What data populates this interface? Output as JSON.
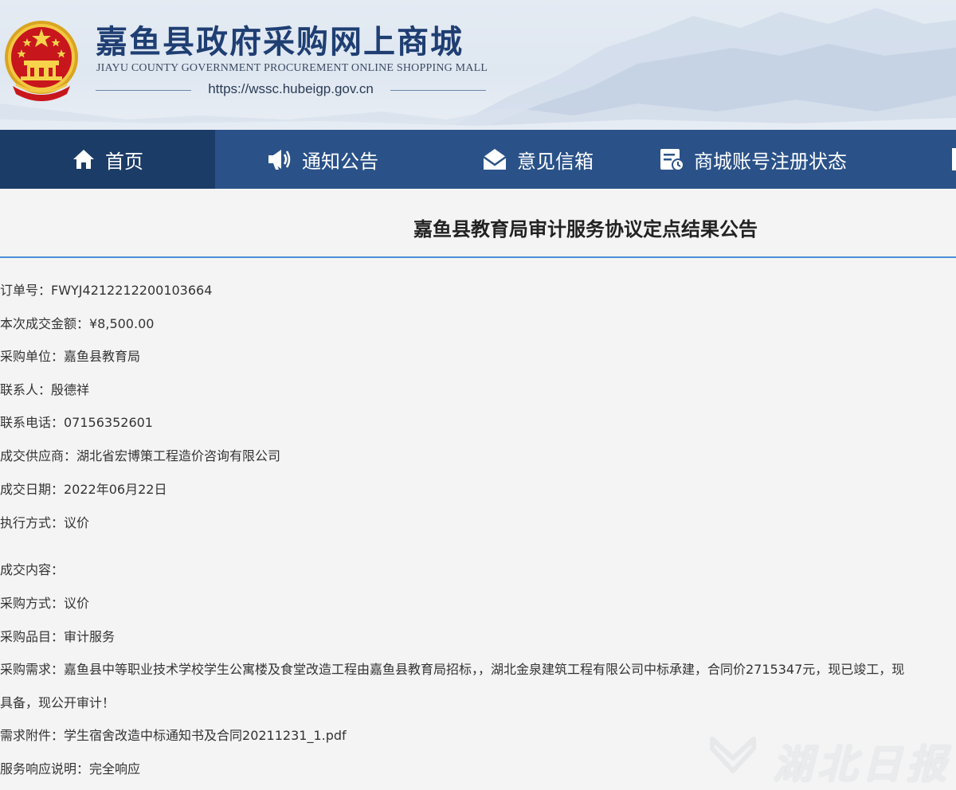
{
  "header": {
    "site_title": "嘉鱼县政府采购网上商城",
    "site_subtitle": "JIAYU COUNTY GOVERNMENT PROCUREMENT ONLINE SHOPPING MALL",
    "site_url": "https://wssc.hubeigp.gov.cn",
    "emblem_icon": "national-emblem-icon"
  },
  "nav": {
    "items": [
      {
        "label": "首页",
        "icon": "home-icon",
        "active": true
      },
      {
        "label": "通知公告",
        "icon": "megaphone-icon",
        "active": false
      },
      {
        "label": "意见信箱",
        "icon": "mailbox-icon",
        "active": false
      },
      {
        "label": "商城账号注册状态",
        "icon": "registration-status-icon",
        "active": false
      }
    ]
  },
  "article": {
    "title": "嘉鱼县教育局审计服务协议定点结果公告",
    "fields": {
      "order_no": "订单号：FWYJ4212212200103664",
      "amount": "本次成交金额：¥8,500.00",
      "purchaser": "采购单位：嘉鱼县教育局",
      "contact": "联系人：殷德祥",
      "phone": "联系电话：07156352601",
      "supplier": "成交供应商：湖北省宏博策工程造价咨询有限公司",
      "deal_date": "成交日期：2022年06月22日",
      "exec_method": "执行方式：议价",
      "deal_content": "成交内容：",
      "purchase_method": "采购方式：议价",
      "purchase_item": "采购品目：审计服务",
      "requirement_line1": "采购需求：嘉鱼县中等职业技术学校学生公寓楼及食堂改造工程由嘉鱼县教育局招标，，湖北金泉建筑工程有限公司中标承建，合同价2715347元，现已竣工，现",
      "requirement_line2": "具备，现公开审计！",
      "attachment_label": "需求附件：",
      "attachment_file": "学生宿舍改造中标通知书及合同20211231_1.pdf",
      "response": "服务响应说明：完全响应"
    }
  },
  "watermark": {
    "text": "湖北日报"
  },
  "colors": {
    "nav_bg": "#2a5289",
    "nav_active_bg": "#1c3c68",
    "title_rule": "#4a90d9",
    "site_title": "#1f3f73"
  }
}
